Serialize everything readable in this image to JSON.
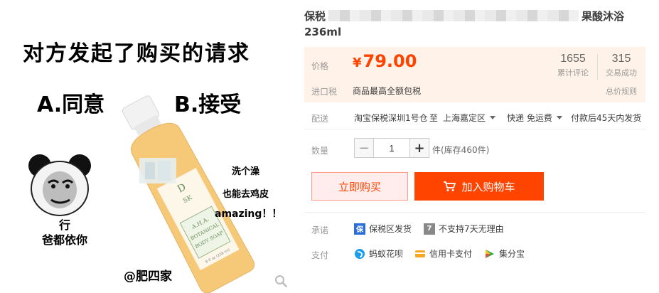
{
  "image": {
    "meme_title": "对方发起了购买的请求",
    "option_a": "A.同意",
    "option_b": "B.接受",
    "panda_caption_line1": "行",
    "panda_caption_line2": "爸都依你",
    "side_line1": "洗个澡",
    "side_line2": "也能去鸡皮",
    "side_line3": "amazing！！",
    "watermark": "@肥四家",
    "bottle_label_line1": "A.H.A.",
    "bottle_label_line2": "BOTANICAL",
    "bottle_label_line3": "BODY SOAP",
    "bottle_brand": "D",
    "bottle_brand_sub": "SK",
    "bottle_volume": "8 fl oz (236 ml)",
    "zoom_icon": "magnifier-icon"
  },
  "product": {
    "title_prefix": "保税",
    "title_suffix": "果酸沐浴",
    "title_line2": "236ml"
  },
  "price": {
    "label": "价格",
    "currency": "¥",
    "value": "79.00",
    "tax_label": "进口税",
    "tax_text": "商品最高全额包税",
    "reviews_count": "1655",
    "reviews_caption": "累计评论",
    "sales_count": "315",
    "sales_caption": "交易成功",
    "tax_rule_link": "总价规则"
  },
  "shipping": {
    "label": "配送",
    "from": "淘宝保税深圳1号仓",
    "to_word": "至",
    "destination": "上海嘉定区",
    "method": "快递 免运费",
    "dispatch": "付款后45天内发货"
  },
  "quantity": {
    "label": "数量",
    "value": "1",
    "minus": "−",
    "plus": "+",
    "stock_text": "件(库存460件)"
  },
  "actions": {
    "buy_now": "立即购买",
    "add_to_cart": "加入购物车"
  },
  "promise": {
    "label": "承诺",
    "items": [
      {
        "icon": "bonded-badge-icon",
        "icon_text": "保",
        "text": "保税区发货",
        "color": "#2b6fd6"
      },
      {
        "icon": "seven-day-icon",
        "icon_text": "7",
        "text": "不支持7天无理由",
        "color": "#888888"
      }
    ]
  },
  "payment": {
    "label": "支付",
    "items": [
      {
        "icon": "huabei-icon",
        "text": "蚂蚁花呗",
        "color": "#1a9cf0"
      },
      {
        "icon": "credit-card-icon",
        "text": "信用卡支付",
        "color": "#f5a623"
      },
      {
        "icon": "jifenbao-icon",
        "text": "集分宝",
        "color": "#29a846"
      }
    ]
  },
  "colors": {
    "accent": "#ff4400",
    "price_bg": "#fff2e8",
    "buy_now_bg": "#ffeded"
  }
}
